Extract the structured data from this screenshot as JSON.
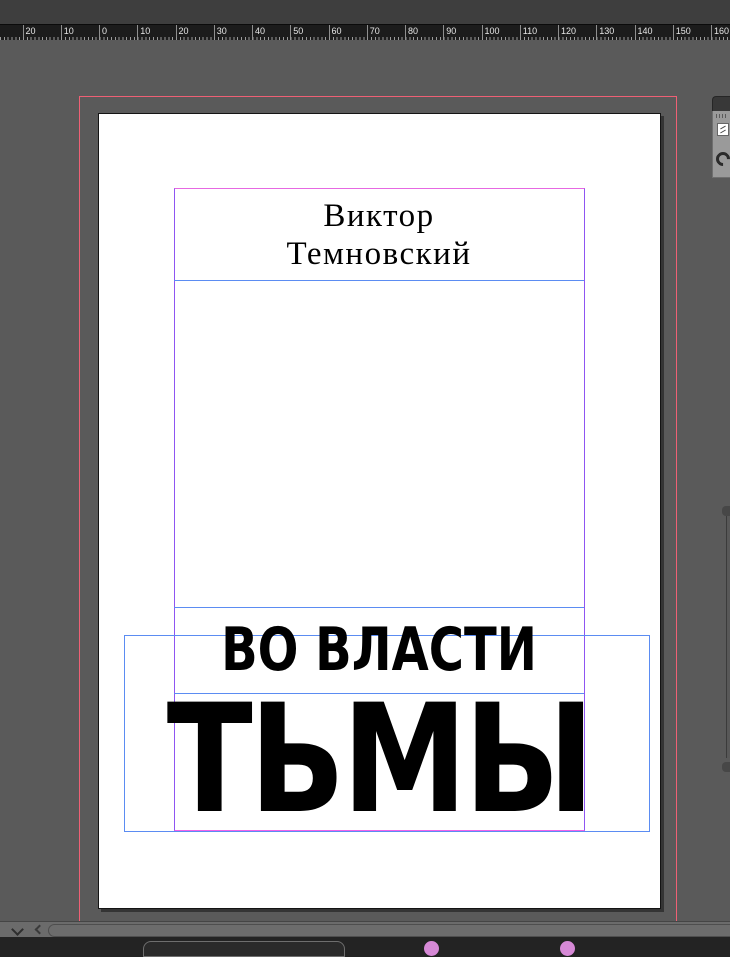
{
  "ruler": {
    "labels": [
      "20",
      "10",
      "0",
      "10",
      "20",
      "30",
      "40",
      "50",
      "60",
      "70",
      "80",
      "90",
      "100",
      "110",
      "120",
      "130",
      "140",
      "150",
      "160"
    ]
  },
  "cover": {
    "author": {
      "line1": "Виктор",
      "line2": "Темновский"
    },
    "series_title": "ВО ВЛАСТИ",
    "main_title": "ТЬМЫ"
  },
  "colors": {
    "bleed_guide_pink": "#EF6075",
    "frame_edge_purple": "#8F55F2",
    "frame_edge_magenta": "#F263E8",
    "frame_edge_magenta_top": "#E668E2",
    "frame_edge_blue": "#5B8CF2",
    "pasteboard_gray": "#5A5A5A",
    "page_white": "#FFFFFF",
    "status_dot_pink": "#D689D6"
  },
  "icons": {
    "scrollbar_collapse": "chevron-down",
    "scroll_left": "chevron-left",
    "panel_grip": "grip-dashes",
    "panel_swatch": "checkered-swatch",
    "panel_tool": "ring-tool-glyph"
  }
}
